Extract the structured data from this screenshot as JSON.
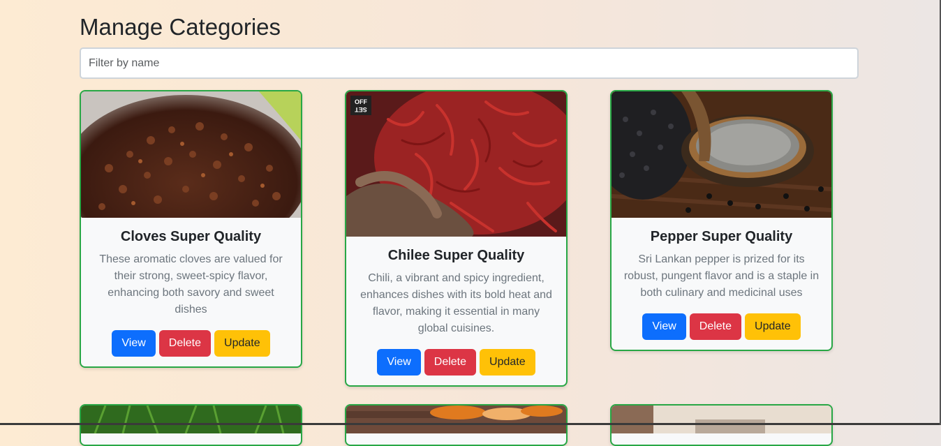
{
  "page": {
    "title": "Manage Categories"
  },
  "filter": {
    "placeholder": "Filter by name",
    "value": ""
  },
  "colors": {
    "card_border": "#28a745",
    "view": "#0d6efd",
    "delete": "#dc3545",
    "update": "#ffc107"
  },
  "cards": [
    {
      "title": "Cloves Super Quality",
      "description": "These aromatic cloves are valued for their strong, sweet-spicy flavor, enhancing both savory and sweet dishes",
      "image": "cloves-photo",
      "view_label": "View",
      "delete_label": "Delete",
      "update_label": "Update"
    },
    {
      "title": "Chilee Super Quality",
      "description": "Chili, a vibrant and spicy ingredient, enhances dishes with its bold heat and flavor, making it essential in many global cuisines.",
      "image": "chili-photo",
      "badge": "OFF SET",
      "view_label": "View",
      "delete_label": "Delete",
      "update_label": "Update"
    },
    {
      "title": "Pepper Super Quality",
      "description": "Sri Lankan pepper is prized for its robust, pungent flavor and is a staple in both culinary and medicinal uses",
      "image": "pepper-photo",
      "view_label": "View",
      "delete_label": "Delete",
      "update_label": "Update"
    },
    {
      "image": "green-leaves-photo"
    },
    {
      "image": "turmeric-photo"
    },
    {
      "image": "spice-jar-photo"
    }
  ]
}
